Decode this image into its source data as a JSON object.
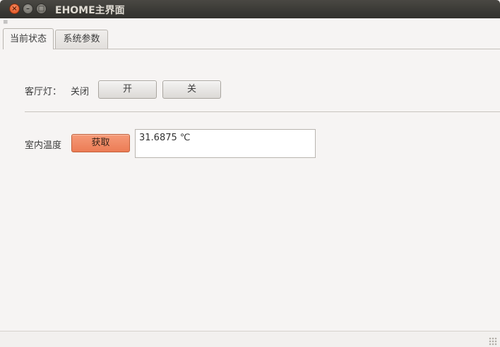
{
  "window": {
    "title": "EHOME主界面"
  },
  "tabs": [
    {
      "label": "当前状态",
      "active": true
    },
    {
      "label": "系统参数",
      "active": false
    }
  ],
  "light": {
    "label": "客厅灯：",
    "status": "关闭",
    "on_button": "开",
    "off_button": "关"
  },
  "temperature": {
    "label": "室内温度",
    "fetch_button": "获取",
    "value": "31.6875 ℃"
  },
  "colors": {
    "accent_button": "#ec7c55",
    "titlebar": "#3a3935",
    "close_button": "#df4a16"
  }
}
